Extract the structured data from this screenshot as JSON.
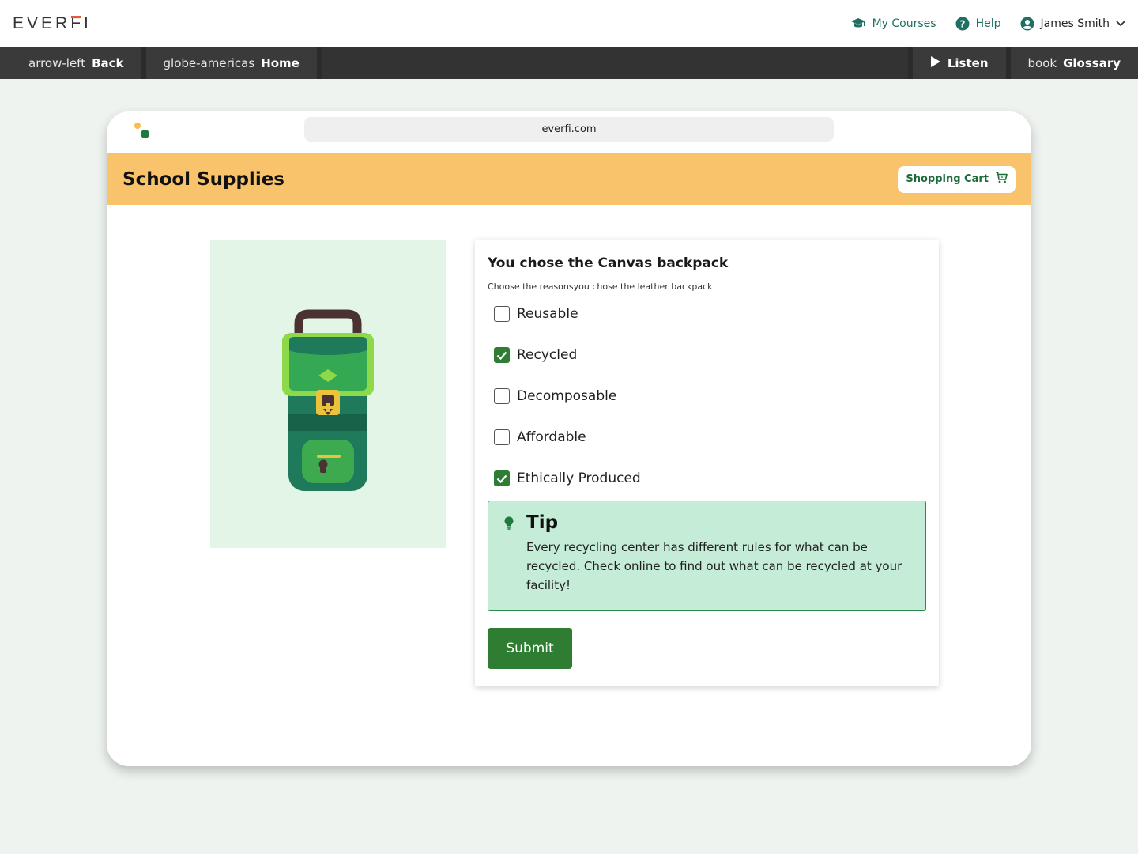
{
  "header": {
    "logo": "EVERFI",
    "nav": {
      "my_courses": "My Courses",
      "help": "Help",
      "user_name": "James Smith"
    }
  },
  "toolbar": {
    "back_icon": "arrow-left",
    "back_label": "Back",
    "home_icon": "globe-americas",
    "home_label": "Home",
    "listen_label": "Listen",
    "glossary_icon": "book",
    "glossary_label": "Glossary"
  },
  "browser": {
    "url": "everfi.com"
  },
  "site": {
    "title": "School Supplies",
    "cart_label": "Shopping Cart"
  },
  "question": {
    "title": "You chose the Canvas backpack",
    "subtitle": "Choose the reasonsyou chose the leather backpack",
    "options": [
      {
        "label": "Reusable",
        "checked": false
      },
      {
        "label": "Recycled",
        "checked": true
      },
      {
        "label": "Decomposable",
        "checked": false
      },
      {
        "label": "Affordable",
        "checked": false
      },
      {
        "label": "Ethically Produced",
        "checked": true
      }
    ]
  },
  "tip": {
    "title": "Tip",
    "body": "Every recycling center has different rules for what can be recycled. Check online to find out what can be recycled at your facility!"
  },
  "submit_label": "Submit",
  "colors": {
    "accent_green": "#2e7d32",
    "header_orange": "#f8c36a",
    "tip_bg": "#c4ecd6",
    "nav_teal": "#1f6f62"
  }
}
